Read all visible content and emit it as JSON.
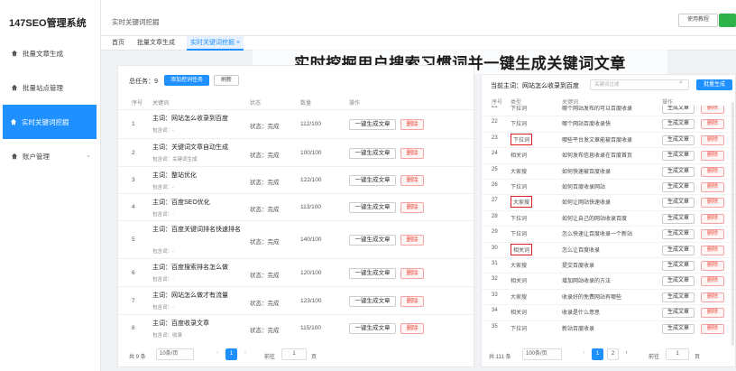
{
  "app": {
    "brand": "147SEO管理系统"
  },
  "sidebar": {
    "items": [
      {
        "label": "批量文章生成",
        "active": false
      },
      {
        "label": "批量站点管理",
        "active": false
      },
      {
        "label": "实时关键词挖掘",
        "active": true
      },
      {
        "label": "账户管理",
        "active": false
      }
    ]
  },
  "topbar": {
    "breadcrumb": "实时关键词挖掘",
    "help_label": "使用教程"
  },
  "tabs": [
    {
      "label": "首页"
    },
    {
      "label": "批量文章生成"
    },
    {
      "label": "实时关键词挖掘 ×"
    }
  ],
  "banner": "实时挖掘用户搜索习惯词并一键生成关键词文章",
  "left": {
    "total_label": "总任务：9",
    "add_btn": "添加挖词任务",
    "refresh_btn": "刷新",
    "headers": [
      "序号",
      "关键词",
      "状态",
      "数量",
      "操作"
    ],
    "gen_label": "一键生成文章",
    "del_label": "删除",
    "rows": [
      {
        "no": "1",
        "main": "主词：网站怎么收录到百度",
        "sub": "包含词：-",
        "status": "状态：完成",
        "count": "112/100"
      },
      {
        "no": "2",
        "main": "主词：关键词文章自动生成",
        "sub": "包含词：关键词生成",
        "status": "状态：完成",
        "count": "100/100"
      },
      {
        "no": "3",
        "main": "主词：整站优化",
        "sub": "包含词：-",
        "status": "状态：完成",
        "count": "122/100"
      },
      {
        "no": "4",
        "main": "主词：百度SEO优化",
        "sub": "包含词：-",
        "status": "状态：完成",
        "count": "113/100"
      },
      {
        "no": "5",
        "main": "主词：百度关键词排名快速排名",
        "sub": "包含词：-",
        "status": "状态：完成",
        "count": "140/100"
      },
      {
        "no": "6",
        "main": "主词：百度搜索排名怎么做",
        "sub": "包含词：-",
        "status": "状态：完成",
        "count": "120/100"
      },
      {
        "no": "7",
        "main": "主词：网站怎么做才有流量",
        "sub": "包含词：-",
        "status": "状态：完成",
        "count": "123/100"
      },
      {
        "no": "8",
        "main": "主词：百度收录文章",
        "sub": "包含词：收录",
        "status": "状态：完成",
        "count": "115/100"
      }
    ],
    "pager": {
      "total": "共 9 条",
      "size": "10条/页",
      "page": "1",
      "goto": "前往",
      "goto_value": "1",
      "suffix": "页"
    }
  },
  "right": {
    "title": "当前主词：网站怎么收录到百度",
    "filter_placeholder": "关键词过滤",
    "batch_btn": "批量生成",
    "headers": [
      "序号",
      "类型",
      "关键词",
      "操作"
    ],
    "gen_label": "生成文章",
    "del_label": "删除",
    "rows": [
      {
        "no": "21",
        "type": "下拉词",
        "kw": "哪个网站发布的可以百度收录",
        "hl": false
      },
      {
        "no": "22",
        "type": "下拉词",
        "kw": "哪个网站百度收录快",
        "hl": false
      },
      {
        "no": "23",
        "type": "下拉词",
        "kw": "哪些平台发文章能被百度收录",
        "hl": true
      },
      {
        "no": "24",
        "type": "相关词",
        "kw": "如何发布信息收录在百度首页",
        "hl": false
      },
      {
        "no": "25",
        "type": "大家搜",
        "kw": "如何快速被百度收录",
        "hl": false
      },
      {
        "no": "26",
        "type": "下拉词",
        "kw": "如何百度收录网站",
        "hl": false
      },
      {
        "no": "27",
        "type": "大家搜",
        "kw": "如何让网站快速收录",
        "hl": true
      },
      {
        "no": "28",
        "type": "下拉词",
        "kw": "如何让自己的网站收录百度",
        "hl": false
      },
      {
        "no": "29",
        "type": "下拉词",
        "kw": "怎么快速让百度收录一个新站",
        "hl": false
      },
      {
        "no": "30",
        "type": "相关词",
        "kw": "怎么让百度收录",
        "hl": true
      },
      {
        "no": "31",
        "type": "大家搜",
        "kw": "提交百度收录",
        "hl": false
      },
      {
        "no": "32",
        "type": "相关词",
        "kw": "增加网站收录的方法",
        "hl": false
      },
      {
        "no": "33",
        "type": "大家搜",
        "kw": "收录好的免费网站有哪些",
        "hl": false
      },
      {
        "no": "34",
        "type": "相关词",
        "kw": "收录是什么意思",
        "hl": false
      },
      {
        "no": "35",
        "type": "下拉词",
        "kw": "新站百度收录",
        "hl": false
      }
    ],
    "pager": {
      "total": "共 111 条",
      "size": "100条/页",
      "page1": "1",
      "page2": "2",
      "goto": "前往",
      "goto_value": "1",
      "suffix": "页"
    }
  },
  "colors": {
    "accent": "#1e90ff",
    "danger": "#e74c3c",
    "highlight": "#e02020"
  }
}
